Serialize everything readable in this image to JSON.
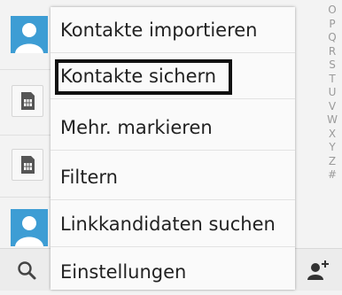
{
  "menu": {
    "items": [
      {
        "label": "Kontakte importieren"
      },
      {
        "label": "Kontakte sichern",
        "highlighted": true
      },
      {
        "label": "Mehr. markieren"
      },
      {
        "label": "Filtern"
      },
      {
        "label": "Linkkandidaten suchen"
      },
      {
        "label": "Einstellungen"
      }
    ]
  },
  "alphabet_index": [
    "O",
    "P",
    "Q",
    "R",
    "S",
    "T",
    "U",
    "V",
    "W",
    "X",
    "Y",
    "Z",
    "#"
  ],
  "bottom_bar": {
    "left_icon": "search-icon",
    "right_icon": "add-contact-icon"
  },
  "colors": {
    "avatar_blue": "#3d9dd4",
    "highlight_border": "#111111"
  }
}
